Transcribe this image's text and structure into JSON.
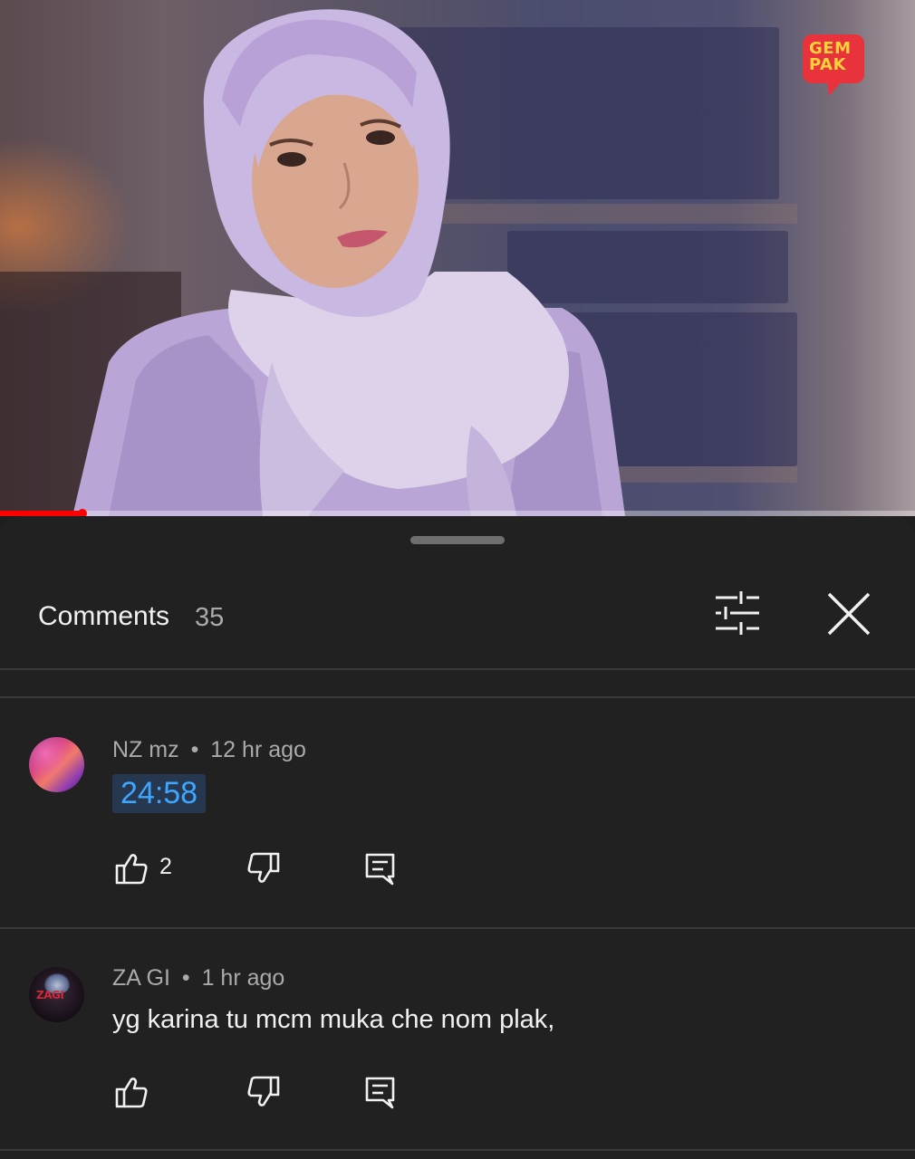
{
  "video": {
    "logo_line1": "GEM",
    "logo_line2": "PAK",
    "progress_fraction": 0.09,
    "accent_color": "#ff0000"
  },
  "comments_panel": {
    "title": "Comments",
    "count": "35",
    "filter_icon": "sliders-icon",
    "close_icon": "close-icon",
    "items": [
      {
        "author": "NZ mz",
        "separator": "•",
        "time": "12 hr ago",
        "timestamp_link": "24:58",
        "likes": "2"
      },
      {
        "author": "ZA GI",
        "separator": "•",
        "time": "1 hr ago",
        "text": "yg karina tu mcm muka che nom plak,",
        "avatar_text": "ZAGI"
      }
    ]
  }
}
